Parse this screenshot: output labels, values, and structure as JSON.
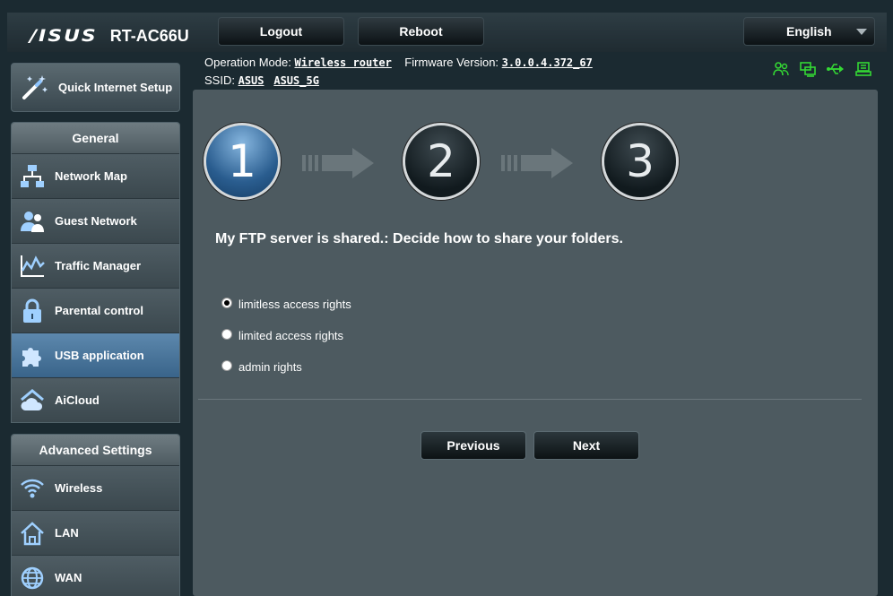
{
  "header": {
    "brand": "/ISUS",
    "model": "RT-AC66U",
    "logout_label": "Logout",
    "reboot_label": "Reboot",
    "language": "English"
  },
  "status": {
    "op_mode_label": "Operation Mode:",
    "op_mode_value": "Wireless router",
    "firmware_label": "Firmware Version:",
    "firmware_value": "3.0.0.4.372_67",
    "ssid_label": "SSID:",
    "ssid_1": "ASUS",
    "ssid_2": "ASUS_5G",
    "icon_color": "#34d834"
  },
  "sidebar": {
    "qis_label": "Quick Internet Setup",
    "general_title": "General",
    "general_items": [
      {
        "label": "Network Map",
        "icon": "network-map-icon"
      },
      {
        "label": "Guest Network",
        "icon": "guest-network-icon"
      },
      {
        "label": "Traffic Manager",
        "icon": "traffic-manager-icon"
      },
      {
        "label": "Parental control",
        "icon": "lock-icon"
      },
      {
        "label": "USB application",
        "icon": "puzzle-icon",
        "active": true
      },
      {
        "label": "AiCloud",
        "icon": "cloud-icon"
      }
    ],
    "advanced_title": "Advanced Settings",
    "advanced_items": [
      {
        "label": "Wireless",
        "icon": "wifi-icon"
      },
      {
        "label": "LAN",
        "icon": "home-icon"
      },
      {
        "label": "WAN",
        "icon": "globe-icon"
      }
    ]
  },
  "main": {
    "steps": [
      "1",
      "2",
      "3"
    ],
    "active_step": 1,
    "description": "My FTP server is shared.: Decide how to share your folders.",
    "options": [
      {
        "label": "limitless access rights",
        "checked": true
      },
      {
        "label": "limited access rights",
        "checked": false
      },
      {
        "label": "admin rights",
        "checked": false
      }
    ],
    "previous_label": "Previous",
    "next_label": "Next"
  }
}
